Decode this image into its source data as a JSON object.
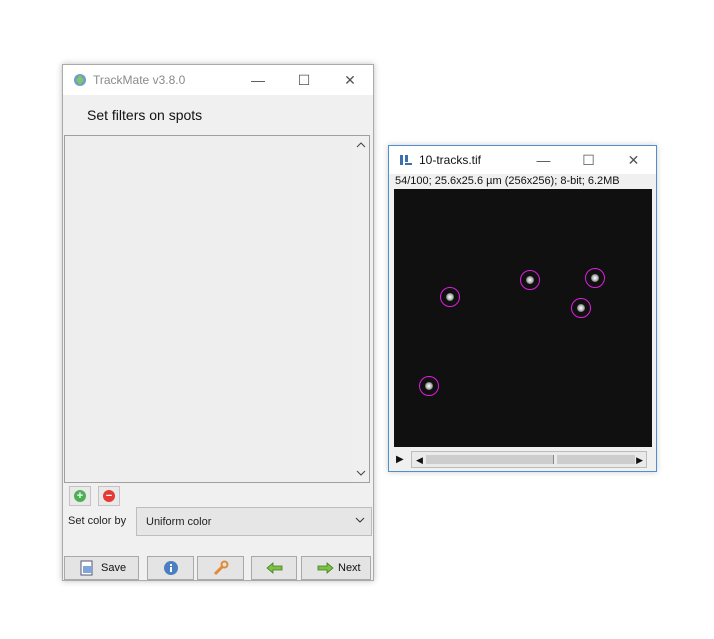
{
  "trackmate": {
    "title": "TrackMate v3.8.0",
    "controls": {
      "minimize": "—",
      "maximize": "☐",
      "close": "✕"
    },
    "panel_title": "Set filters on spots",
    "add_filter_icon": "plus-icon",
    "remove_filter_icon": "minus-icon",
    "color_label": "Set color by",
    "color_value": "Uniform color",
    "buttons": {
      "save": "Save",
      "next": "Next"
    }
  },
  "image_window": {
    "title": "10-tracks.tif",
    "controls": {
      "minimize": "—",
      "maximize": "☐",
      "close": "✕"
    },
    "info": "54/100; 25.6x25.6 µm (256x256); 8-bit; 6.2MB",
    "scroll_play": "▶",
    "scroll_left": "◀",
    "scroll_right": "▶"
  },
  "colors": {
    "spot_ring": "#e11ce1",
    "accent": "#4e8fd2"
  }
}
